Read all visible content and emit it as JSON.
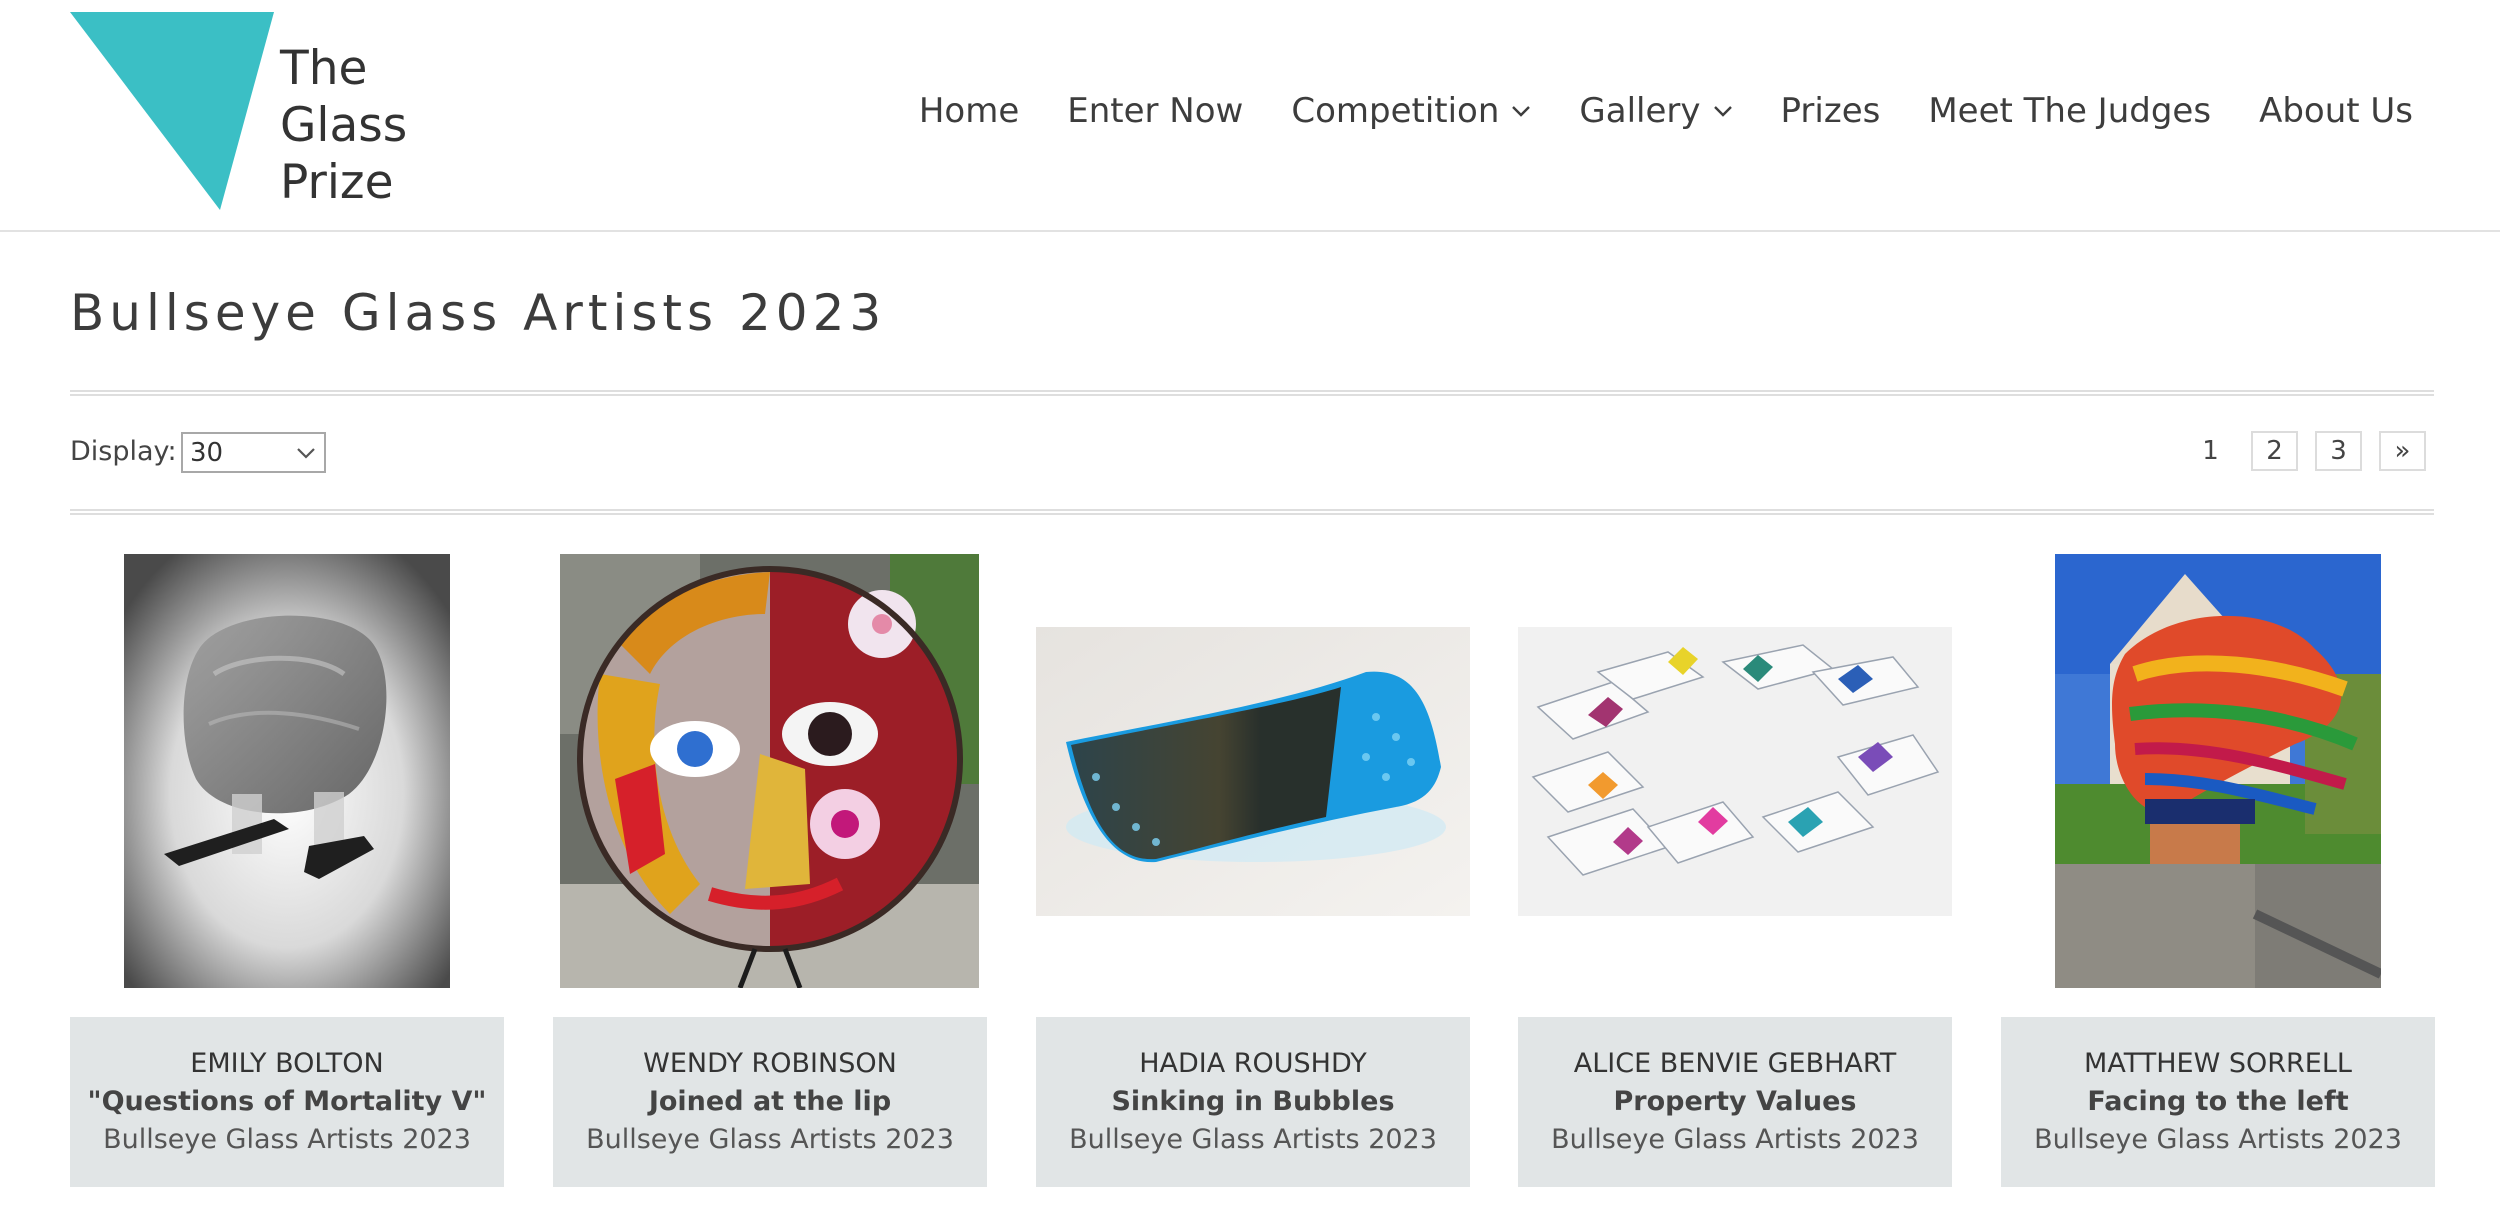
{
  "logo": {
    "line1": "The",
    "line2": "Glass",
    "line3": "Prize",
    "color": "#3bbfc5"
  },
  "nav": {
    "home": "Home",
    "enter_now": "Enter Now",
    "competition": "Competition",
    "gallery": "Gallery",
    "prizes": "Prizes",
    "meet_the_judges": "Meet The Judges",
    "about_us": "About Us"
  },
  "page": {
    "title": "Bullseye Glass Artists 2023"
  },
  "display": {
    "label": "Display:",
    "selected": "30"
  },
  "pagination": {
    "p1": "1",
    "p2": "2",
    "p3": "3",
    "next": "»"
  },
  "gallery": [
    {
      "artist": "EMILY BOLTON",
      "title": "\"Questions of Mortality V\"",
      "category": "Bullseye Glass Artists 2023",
      "image": "frosted-glass-sculpture"
    },
    {
      "artist": "WENDY ROBINSON",
      "title": "Joined at the lip",
      "category": "Bullseye Glass Artists 2023",
      "image": "glass-face-roundel"
    },
    {
      "artist": "HADIA ROUSHDY",
      "title": "Sinking in Bubbles",
      "category": "Bullseye Glass Artists 2023",
      "image": "blue-glass-plate"
    },
    {
      "artist": "ALICE BENVIE GEBHART",
      "title": "Property Values",
      "category": "Bullseye Glass Artists 2023",
      "image": "glass-house-tiles"
    },
    {
      "artist": "MATTHEW SORRELL",
      "title": "Facing to the left",
      "category": "Bullseye Glass Artists 2023",
      "image": "rainbow-glass-head"
    }
  ]
}
